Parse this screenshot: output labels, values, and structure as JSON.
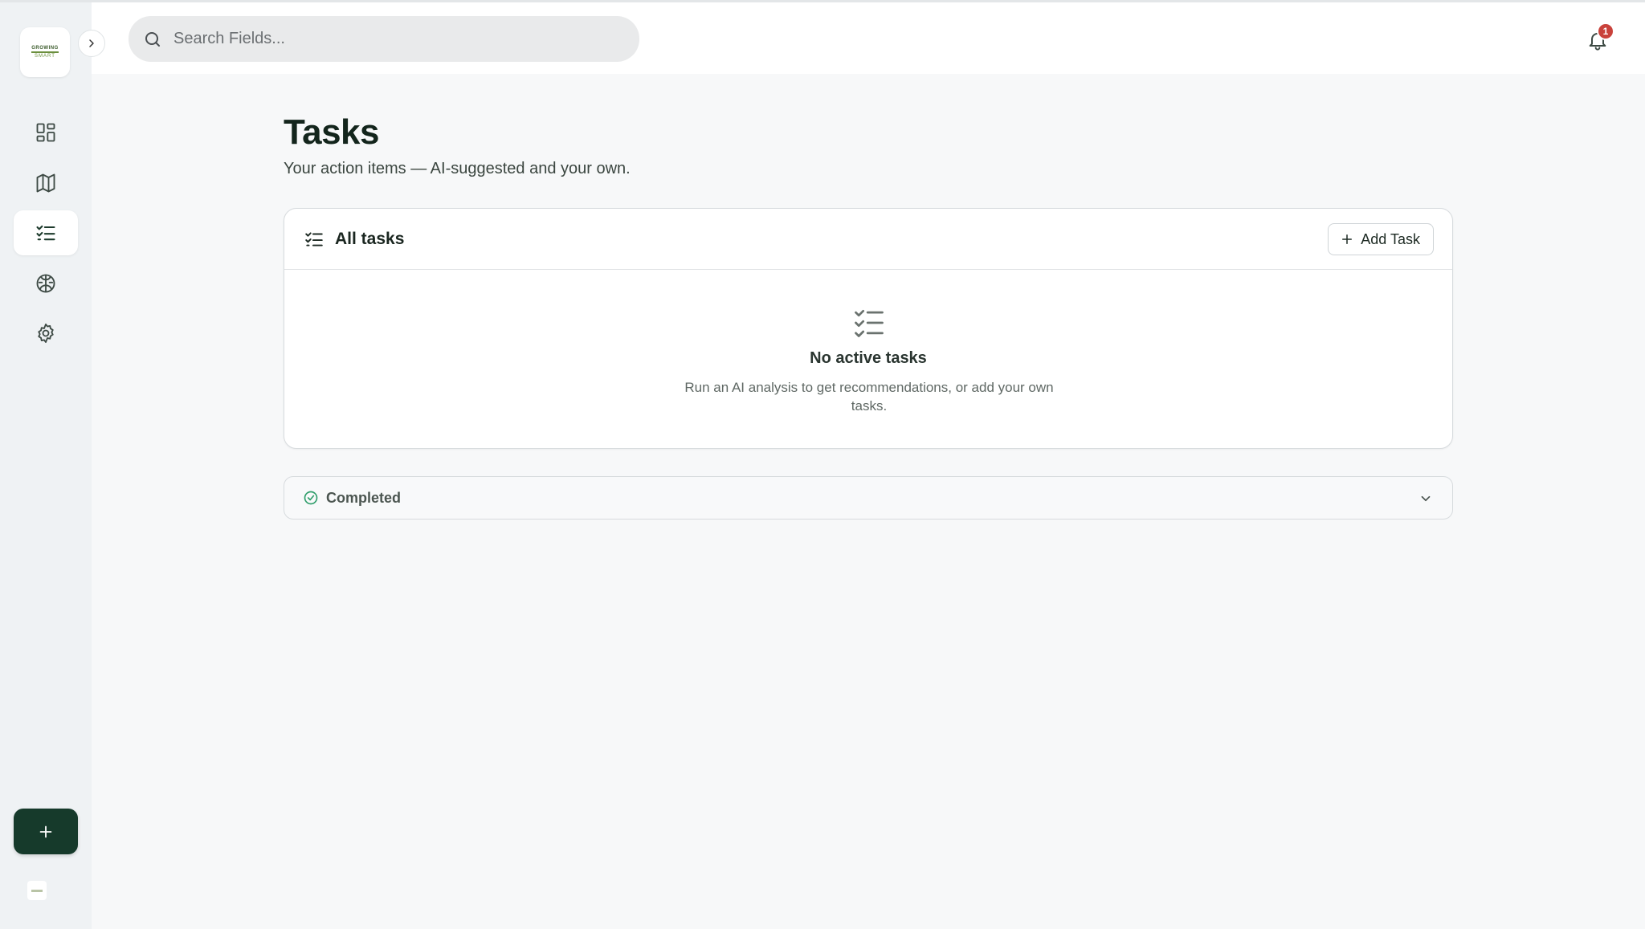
{
  "app": {
    "logo_text_top": "GROWING",
    "logo_text_bottom": "SMART"
  },
  "search": {
    "placeholder": "Search Fields..."
  },
  "notifications": {
    "count": "1"
  },
  "sidebar": {
    "items": [
      {
        "name": "dashboard",
        "icon": "grid-icon",
        "active": false
      },
      {
        "name": "map",
        "icon": "map-icon",
        "active": false
      },
      {
        "name": "tasks",
        "icon": "list-checks-icon",
        "active": true
      },
      {
        "name": "ai",
        "icon": "brain-icon",
        "active": false
      },
      {
        "name": "settings",
        "icon": "gear-icon",
        "active": false
      }
    ]
  },
  "page": {
    "title": "Tasks",
    "subtitle": "Your action items — AI-suggested and your own."
  },
  "tasks_card": {
    "title": "All tasks",
    "add_label": "Add Task",
    "empty_title": "No active tasks",
    "empty_desc": "Run an AI analysis to get recommendations, or add your own tasks."
  },
  "completed": {
    "label": "Completed"
  },
  "colors": {
    "brand_dark": "#163a2b",
    "badge": "#c9423b",
    "success": "#2f9e6b"
  }
}
